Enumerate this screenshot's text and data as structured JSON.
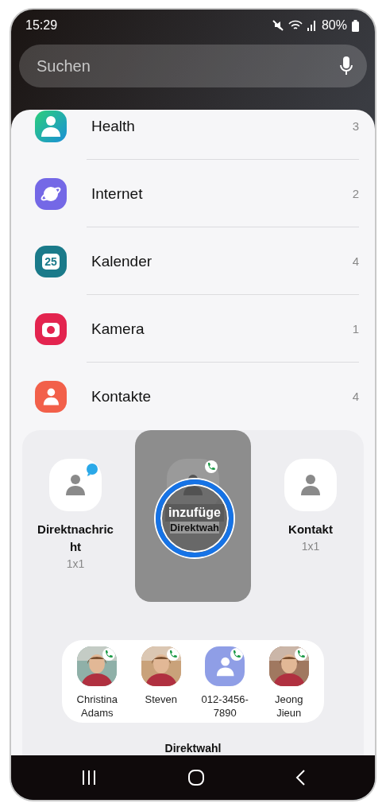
{
  "status_bar": {
    "time": "15:29",
    "battery": "80%"
  },
  "search": {
    "placeholder": "Suchen"
  },
  "apps": [
    {
      "name": "Health",
      "count": "3",
      "kind": "health"
    },
    {
      "name": "Internet",
      "count": "2",
      "kind": "internet"
    },
    {
      "name": "Kalender",
      "count": "4",
      "kind": "calendar",
      "icon_text": "25"
    },
    {
      "name": "Kamera",
      "count": "1",
      "kind": "camera"
    },
    {
      "name": "Kontakte",
      "count": "4",
      "kind": "contacts"
    }
  ],
  "widget_panel": {
    "widgets": [
      {
        "kind": "message",
        "name": "Direktnachricht",
        "size": "1x1",
        "selected": false
      },
      {
        "kind": "dial",
        "action": "inzufüge",
        "caption": "Direktwah",
        "selected": true
      },
      {
        "kind": "contact",
        "name": "Kontakt",
        "size": "1x1",
        "selected": false
      }
    ],
    "contacts": [
      {
        "name": "Christina Adams",
        "color": "#8fb0a8"
      },
      {
        "name": "Steven",
        "color": "#c9a27a"
      },
      {
        "name": "012-3456-7890",
        "kind": "number",
        "color": "#8f9ee6"
      },
      {
        "name": "Jeong Jieun",
        "color": "#a07860"
      }
    ],
    "title": "Direktwahl"
  }
}
